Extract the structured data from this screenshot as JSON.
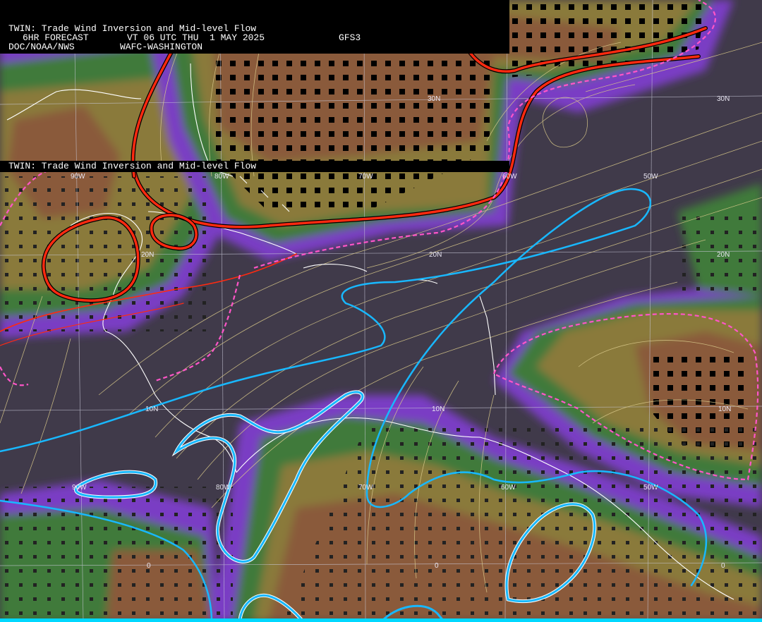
{
  "header": {
    "title": "TWIN: Trade Wind Inversion and Mid-level Flow",
    "forecast": "6HR FORECAST",
    "valid_time": "VT 06 UTC THU  1 MAY 2025",
    "model": "GFS3",
    "agency": "DOC/NOAA/NWS",
    "center": "WAFC-WASHINGTON"
  },
  "header_repeat": {
    "title": "TWIN: Trade Wind Inversion and Mid-level Flow"
  },
  "grid_labels": {
    "lat_30": "30N",
    "lat_20": "20N",
    "lat_10": "10N",
    "lat_0": "0",
    "lon_90": "90W",
    "lon_80": "80W",
    "lon_70": "70W",
    "lon_60": "60W",
    "lon_50": "50W"
  },
  "colors": {
    "background": "#403a4a",
    "purple": "#7a3cc4",
    "blue": "#4f4fa0",
    "green": "#3f7a3a",
    "olive": "#8a7a3a",
    "brown": "#8a5a3a",
    "red_contour": "#ff2a10",
    "cyan_contour": "#18b8ff",
    "pink_dashed": "#ff55c8",
    "coastline": "#ffffff",
    "streamline": "#d9c98a"
  }
}
